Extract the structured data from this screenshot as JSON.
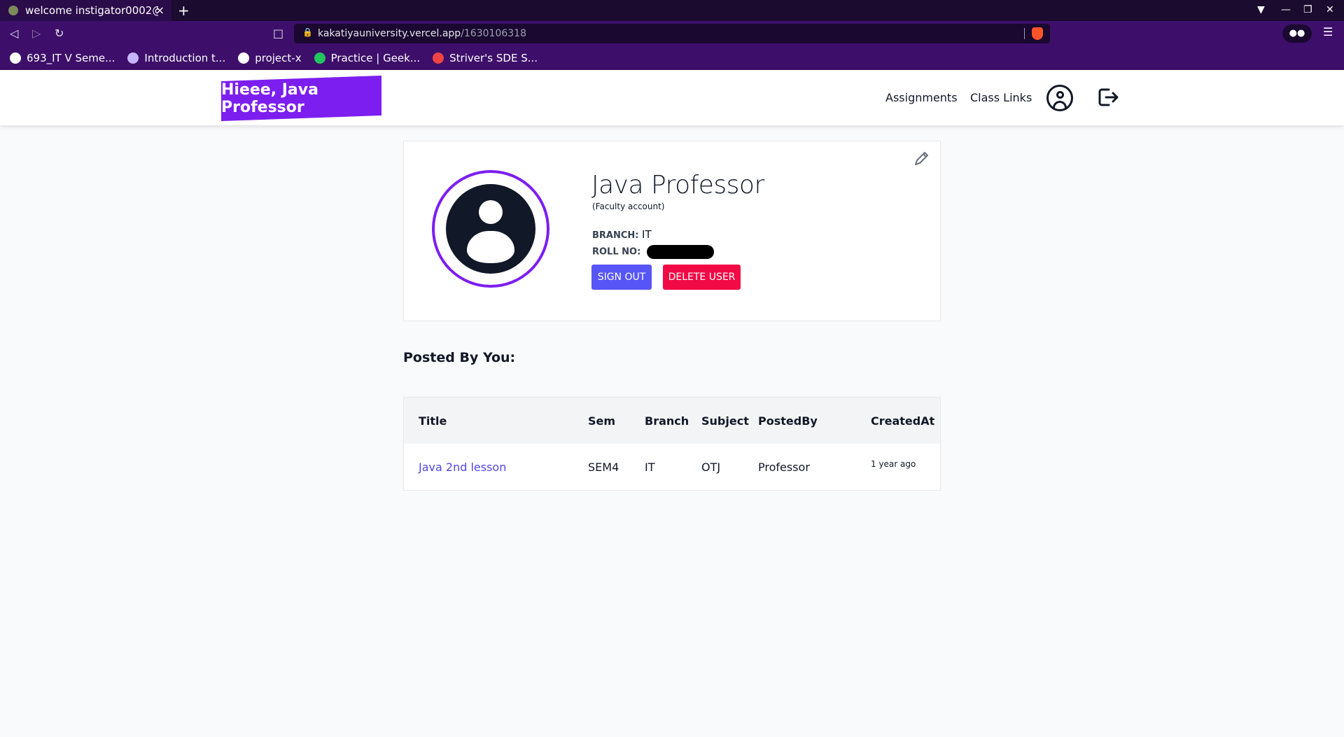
{
  "browser": {
    "tab_title": "welcome instigator0002@",
    "tab_close": "×",
    "new_tab": "+",
    "url_host": "kakatiyauniversity.vercel.app",
    "url_path": "/1630106318",
    "bookmarks": [
      {
        "label": "693_IT V Seme...",
        "color": "#ffffff"
      },
      {
        "label": "Introduction t...",
        "color": "#c4b5fd"
      },
      {
        "label": "project-x",
        "color": "#ffffff"
      },
      {
        "label": "Practice | Geek...",
        "color": "#22c55e"
      },
      {
        "label": "Striver's SDE S...",
        "color": "#ef4444"
      }
    ]
  },
  "header": {
    "brand": "Hieee, Java Professor",
    "nav": [
      "Assignments",
      "Class Links"
    ]
  },
  "profile": {
    "name": "Java Professor",
    "account_type": "(Faculty account)",
    "branch_label": "BRANCH:",
    "branch_value": "IT",
    "roll_label": "ROLL NO:",
    "sign_out": "SIGN OUT",
    "delete_user": "DELETE USER"
  },
  "posts": {
    "section_title": "Posted By You:",
    "columns": [
      "Title",
      "Sem",
      "Branch",
      "Subject",
      "PostedBy",
      "CreatedAt"
    ],
    "rows": [
      {
        "title": "Java 2nd lesson",
        "sem": "SEM4",
        "branch": "IT",
        "subject": "OTJ",
        "posted_by": "Professor",
        "created_at": "1 year ago"
      }
    ]
  },
  "colors": {
    "brand": "#7c1ef0",
    "sign_out": "#5755f6",
    "delete": "#f10a45",
    "link": "#4f46e5"
  }
}
